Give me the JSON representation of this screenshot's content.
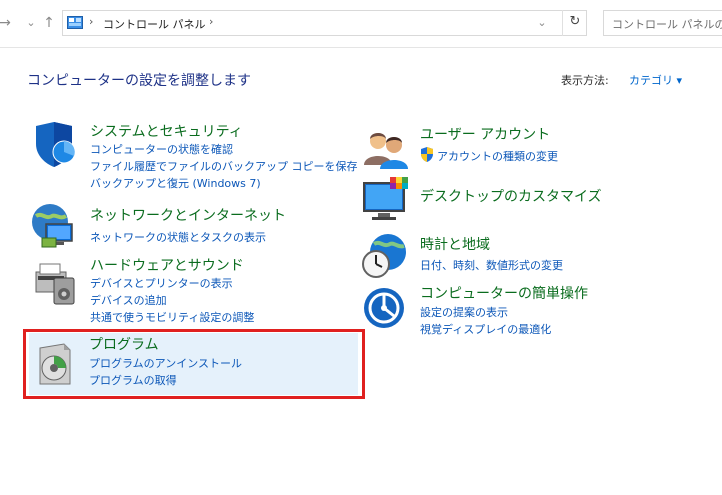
{
  "nav": {
    "forward_glyph": "→",
    "recent_glyph": "⌄",
    "up_glyph": "↑",
    "breadcrumb": "コントロール パネル",
    "breadcrumb_sep": "›",
    "dropdown_glyph": "⌄",
    "refresh_glyph": "↻",
    "search_placeholder": "コントロール パネルの検"
  },
  "header": {
    "title": "コンピューターの設定を調整します",
    "view_by_label": "表示方法:",
    "view_by_value": "カテゴリ ▾"
  },
  "categories": [
    {
      "title": "システムとセキュリティ",
      "icon": "shield-icon",
      "links": [
        "コンピューターの状態を確認",
        "ファイル履歴でファイルのバックアップ コピーを保存",
        "バックアップと復元 (Windows 7)"
      ]
    },
    {
      "title": "ネットワークとインターネット",
      "icon": "network-icon",
      "links": [
        "ネットワークの状態とタスクの表示"
      ]
    },
    {
      "title": "ハードウェアとサウンド",
      "icon": "printer-icon",
      "links": [
        "デバイスとプリンターの表示",
        "デバイスの追加",
        "共通で使うモビリティ設定の調整"
      ]
    },
    {
      "title": "プログラム",
      "icon": "programs-icon",
      "links": [
        "プログラムのアンインストール",
        "プログラムの取得"
      ]
    },
    {
      "title": "ユーザー アカウント",
      "icon": "users-icon",
      "links": [
        "アカウントの種類の変更"
      ]
    },
    {
      "title": "デスクトップのカスタマイズ",
      "icon": "desktop-icon",
      "links": []
    },
    {
      "title": "時計と地域",
      "icon": "clock-globe-icon",
      "links": [
        "日付、時刻、数値形式の変更"
      ]
    },
    {
      "title": "コンピューターの簡単操作",
      "icon": "ease-of-access-icon",
      "links": [
        "設定の提案の表示",
        "視覚ディスプレイの最適化"
      ]
    }
  ],
  "colors": {
    "title": "#0a6c1e",
    "link": "#0c57b8",
    "highlight": "#e0201f"
  }
}
